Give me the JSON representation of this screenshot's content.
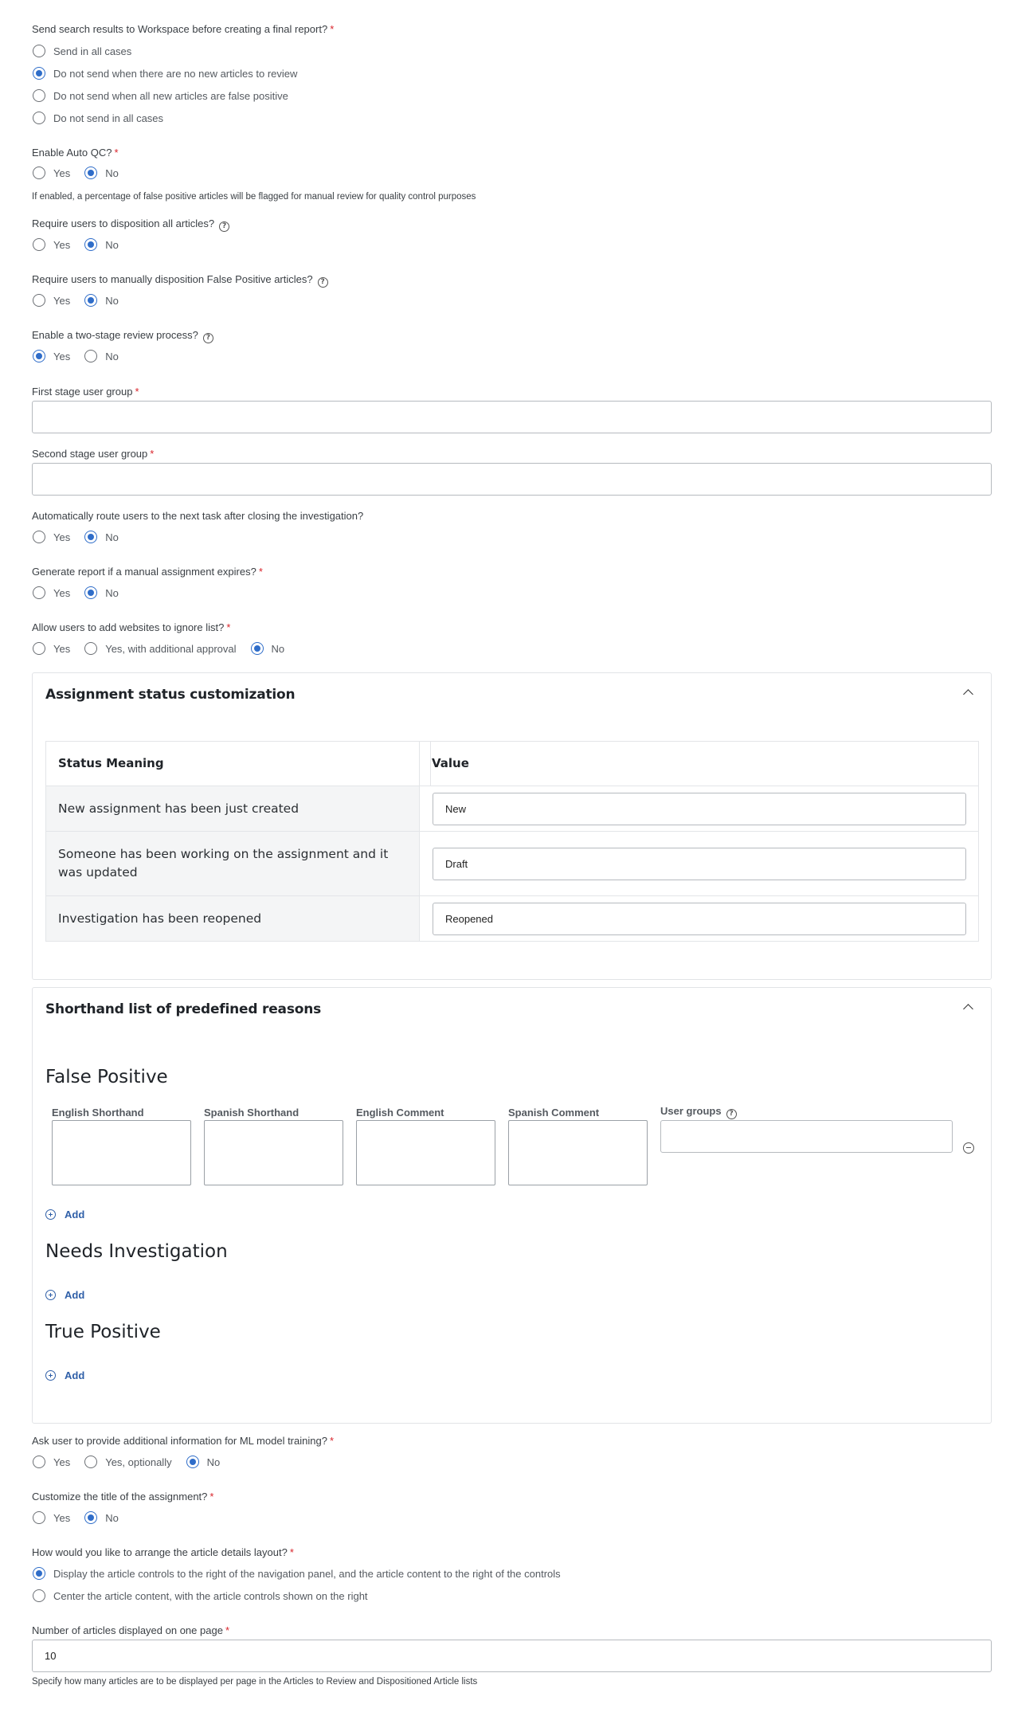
{
  "questions": {
    "send_results": {
      "label": "Send search results to Workspace before creating a final report?",
      "required": "*",
      "options": [
        "Send in all cases",
        "Do not send when there are no new articles to review",
        "Do not send when all new articles are false positive",
        "Do not send in all cases"
      ],
      "selected": "Do not send when there are no new articles to review"
    },
    "auto_qc": {
      "label": "Enable Auto QC?",
      "required": "*",
      "options": [
        "Yes",
        "No"
      ],
      "selected": "No",
      "hint": "If enabled, a percentage of false positive articles will be flagged for manual review for quality control purposes"
    },
    "disposition_all": {
      "label": "Require users to disposition all articles?",
      "help_icon": "?",
      "options": [
        "Yes",
        "No"
      ],
      "selected": "No"
    },
    "manual_fp": {
      "label": "Require users to manually disposition False Positive articles?",
      "help_icon": "?",
      "options": [
        "Yes",
        "No"
      ],
      "selected": "No"
    },
    "two_stage": {
      "label": "Enable a two-stage review process?",
      "help_icon": "?",
      "options": [
        "Yes",
        "No"
      ],
      "selected": "Yes"
    },
    "first_stage_group": {
      "label": "First stage user group",
      "required": "*",
      "value": ""
    },
    "second_stage_group": {
      "label": "Second stage user group",
      "required": "*",
      "value": ""
    },
    "auto_route": {
      "label": "Automatically route users to the next task after closing the investigation?",
      "options": [
        "Yes",
        "No"
      ],
      "selected": "No"
    },
    "report_expire": {
      "label": "Generate report if a manual assignment expires?",
      "required": "*",
      "options": [
        "Yes",
        "No"
      ],
      "selected": "No"
    },
    "ignore_list": {
      "label": "Allow users to add websites to ignore list?",
      "required": "*",
      "options": [
        "Yes",
        "Yes, with additional approval",
        "No"
      ],
      "selected": "No"
    },
    "ml_training": {
      "label": "Ask user to provide additional information for ML model training?",
      "required": "*",
      "options": [
        "Yes",
        "Yes, optionally",
        "No"
      ],
      "selected": "No"
    },
    "custom_title": {
      "label": "Customize the title of the assignment?",
      "required": "*",
      "options": [
        "Yes",
        "No"
      ],
      "selected": "No"
    },
    "layout": {
      "label": "How would you like to arrange the article details layout?",
      "required": "*",
      "options": [
        "Display the article controls to the right of the navigation panel, and the article content to the right of the controls",
        "Center the article content, with the article controls shown on the right"
      ],
      "selected": "Display the article controls to the right of the navigation panel, and the article content to the right of the controls"
    },
    "articles_per_page": {
      "label": "Number of articles displayed on one page",
      "required": "*",
      "value": "10",
      "hint": "Specify how many articles are to be displayed per page in the Articles to Review and Dispositioned Article lists"
    }
  },
  "status_panel": {
    "title": "Assignment status customization",
    "columns": [
      "Status Meaning",
      "Value"
    ],
    "rows": [
      {
        "meaning": "New assignment has been just created",
        "value": "New"
      },
      {
        "meaning": "Someone has been working on the assignment and it was updated",
        "value": "Draft"
      },
      {
        "meaning": "Investigation has been reopened",
        "value": "Reopened"
      }
    ]
  },
  "reasons_panel": {
    "title": "Shorthand list of predefined reasons",
    "columns": [
      "English Shorthand",
      "Spanish Shorthand",
      "English Comment",
      "Spanish Comment",
      "User groups"
    ],
    "help_icon": "?",
    "sections": [
      "False Positive",
      "Needs Investigation",
      "True Positive"
    ],
    "add_label": "Add"
  }
}
